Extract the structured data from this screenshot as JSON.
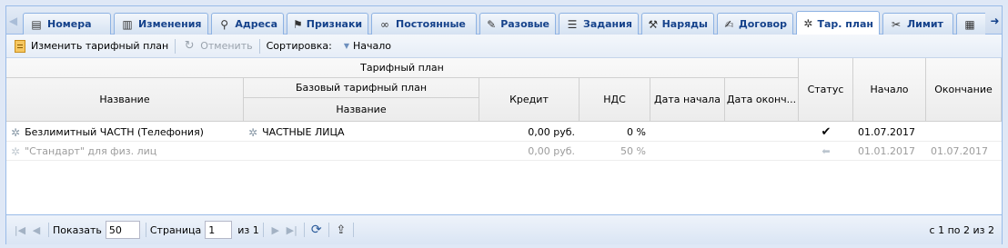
{
  "tabs": [
    {
      "label": "Номера",
      "icon": "sim-card-icon"
    },
    {
      "label": "Изменения",
      "icon": "changes-doc-icon"
    },
    {
      "label": "Адреса",
      "icon": "map-pin-icon"
    },
    {
      "label": "Признаки",
      "icon": "tags-icon"
    },
    {
      "label": "Постоянные",
      "icon": "link-icon"
    },
    {
      "label": "Разовые",
      "icon": "wrench-icon"
    },
    {
      "label": "Задания",
      "icon": "tasks-icon"
    },
    {
      "label": "Наряды",
      "icon": "tools-icon"
    },
    {
      "label": "Договор",
      "icon": "contract-icon"
    },
    {
      "label": "Тар. план",
      "icon": "tariff-icon"
    },
    {
      "label": "Лимит",
      "icon": "scissors-icon"
    },
    {
      "label": "",
      "icon": "chip-icon"
    }
  ],
  "toolbar": {
    "change_plan": "Изменить тарифный план",
    "cancel": "Отменить",
    "sort_label": "Сортировка:",
    "sort_value": "Начало"
  },
  "grid": {
    "group_header": "Тарифный план",
    "name_header": "Название",
    "base_plan_header": "Базовый тарифный план",
    "base_name_header": "Название",
    "credit_header": "Кредит",
    "vat_header": "НДС",
    "start_date_header": "Дата начала",
    "end_date_header": "Дата оконч...",
    "status_header": "Статус",
    "begin_header": "Начало",
    "end_header": "Окончание",
    "rows": [
      {
        "name": "Безлимитный ЧАСТН (Телефония)",
        "base_name": "ЧАСТНЫЕ ЛИЦА",
        "credit": "0,00 руб.",
        "vat": "0 %",
        "start_date": "",
        "end_date": "",
        "status": "✔",
        "begin": "01.07.2017",
        "end": "",
        "dim": false
      },
      {
        "name": "\"Стандарт\" для физ. лиц",
        "base_name": "",
        "credit": "0,00 руб.",
        "vat": "50 %",
        "start_date": "",
        "end_date": "",
        "status": "⬅",
        "begin": "01.01.2017",
        "end": "01.07.2017",
        "dim": true
      }
    ]
  },
  "pager": {
    "show_label": "Показать",
    "page_size": "50",
    "page_label": "Страница",
    "page": "1",
    "of_label": "из 1",
    "summary": "с 1 по 2 из 2"
  }
}
